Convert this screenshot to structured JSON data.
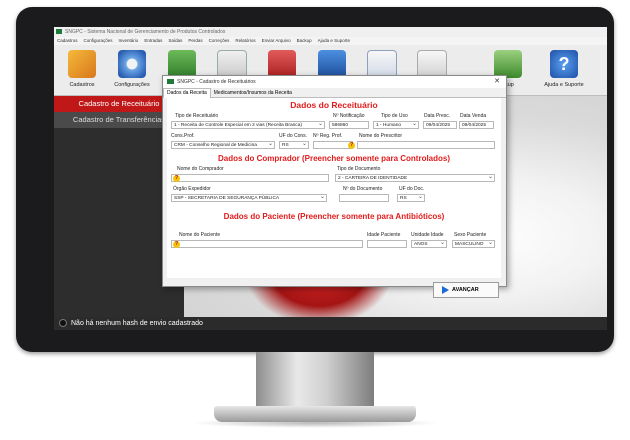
{
  "app": {
    "title": "SNGPC - Sistema Nacional de Gerenciamento de Produtos Controlados",
    "menu": [
      "Cadastros",
      "Configurações",
      "Inventário",
      "Entradas",
      "Saídas",
      "Perdas",
      "Correções",
      "Relatórios",
      "Enviar Arquivo",
      "Backup",
      "Ajuda e Suporte"
    ],
    "toolbar": [
      "Cadastros",
      "Configurações",
      "",
      "",
      "",
      "",
      "",
      "",
      "ckup",
      "Ajuda e Suporte"
    ],
    "left_panel": {
      "active": "Cadastro de Receituário",
      "second": "Cadastro de Transferências"
    },
    "status": "Não há nenhum hash de envio cadastrado"
  },
  "dialog": {
    "title": "SNGPC - Cadastro de Receituários",
    "tabs": [
      "Dados da Receita",
      "Medicamentos/Insumos da Receita"
    ],
    "sections": {
      "receituario": "Dados do Receituário",
      "comprador": "Dados do Comprador (Preencher somente para Controlados)",
      "paciente": "Dados do Paciente (Preencher somente para Antibióticos)"
    },
    "fields": {
      "tipo_receituario": {
        "label": "Tipo de Receituário",
        "value": "1 - Receita de Controle Especial em 2 vias (Receita Branca)"
      },
      "n_notificacao": {
        "label": "Nº Notificação",
        "value": "586860"
      },
      "tipo_uso": {
        "label": "Tipo de Uso",
        "value": "1 - Humano"
      },
      "data_presc": {
        "label": "Data Presc.",
        "value": "09/04/2025"
      },
      "data_venda": {
        "label": "Data Venda",
        "value": "09/04/2025"
      },
      "cons_prof": {
        "label": "Cons.Prof.",
        "value": "CRM - Conselho Regional de Medicina"
      },
      "uf_cons": {
        "label": "UF do Cons.",
        "value": "RS"
      },
      "n_reg_prof": {
        "label": "Nº Reg. Prof.",
        "value": ""
      },
      "nome_prescritor": {
        "label": "Nome do Prescritor",
        "value": ""
      },
      "nome_comprador": {
        "label": "Nome do Comprador",
        "value": ""
      },
      "tipo_documento": {
        "label": "Tipo de Documento",
        "value": "2 - CARTEIRA DE IDENTIDADE"
      },
      "orgao_expedidor": {
        "label": "Órgão Expedidor",
        "value": "SSP - SECRETARIA DE SEGURANÇA PÚBLICA"
      },
      "n_documento": {
        "label": "Nº do Documento",
        "value": ""
      },
      "uf_doc": {
        "label": "UF do Doc.",
        "value": "RS"
      },
      "nome_paciente": {
        "label": "Nome do Paciente",
        "value": ""
      },
      "idade_paciente": {
        "label": "Idade Paciente",
        "value": ""
      },
      "unidade_idade": {
        "label": "Unidade Idade",
        "value": "ANOS"
      },
      "sexo_paciente": {
        "label": "Sexo Paciente",
        "value": "MASCULINO"
      }
    },
    "next_button": "AVANÇAR"
  }
}
